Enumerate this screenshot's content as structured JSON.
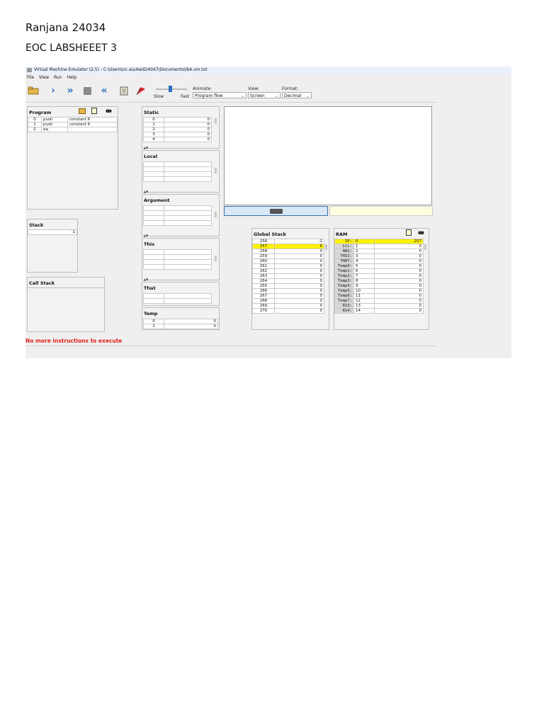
{
  "doc": {
    "author": "Ranjana 24034",
    "subtitle": "EOC LABSHEEET 3"
  },
  "window": {
    "title": "Virtual Machine Emulator (2.5) - C:\\Users\\nc.a\\u4aid24047\\Documents\\lb4.vm.txt"
  },
  "menu": [
    "File",
    "View",
    "Run",
    "Help"
  ],
  "toolbar": {
    "slow_label": "Slow",
    "fast_label": "Fast",
    "animate_label": "Animate:",
    "animate_value": "Program flow",
    "view_label": "View:",
    "view_value": "Screen",
    "format_label": "Format:",
    "format_value": "Decimal",
    "speed": 0.45
  },
  "program": {
    "title": "Program",
    "rows": [
      {
        "idx": "0",
        "op": "push",
        "arg": "constant 6"
      },
      {
        "idx": "1",
        "op": "push",
        "arg": "constant 6"
      },
      {
        "idx": "2",
        "op": "eq",
        "arg": ""
      }
    ]
  },
  "stack": {
    "title": "Stack",
    "values": [
      "-1"
    ]
  },
  "call_stack": {
    "title": "Call Stack"
  },
  "static": {
    "title": "Static",
    "rows": [
      [
        "0",
        "0"
      ],
      [
        "1",
        "0"
      ],
      [
        "2",
        "0"
      ],
      [
        "3",
        "0"
      ],
      [
        "4",
        "0"
      ]
    ]
  },
  "local": {
    "title": "Local"
  },
  "argument": {
    "title": "Argument"
  },
  "this": {
    "title": "This"
  },
  "that": {
    "title": "That"
  },
  "temp": {
    "title": "Temp",
    "rows": [
      [
        "0",
        "0"
      ],
      [
        "1",
        "0"
      ]
    ]
  },
  "global_stack": {
    "title": "Global Stack",
    "rows": [
      [
        "256",
        "-1"
      ],
      [
        "257",
        "6"
      ],
      [
        "258",
        "0"
      ],
      [
        "259",
        "0"
      ],
      [
        "260",
        "0"
      ],
      [
        "261",
        "0"
      ],
      [
        "262",
        "0"
      ],
      [
        "263",
        "0"
      ],
      [
        "264",
        "0"
      ],
      [
        "265",
        "0"
      ],
      [
        "266",
        "0"
      ],
      [
        "267",
        "0"
      ],
      [
        "268",
        "0"
      ],
      [
        "269",
        "0"
      ],
      [
        "270",
        "0"
      ]
    ],
    "highlight_row": 1
  },
  "ram": {
    "title": "RAM",
    "rows": [
      [
        "SP:",
        "0",
        "257"
      ],
      [
        "LCL:",
        "1",
        "0"
      ],
      [
        "ARG:",
        "2",
        "0"
      ],
      [
        "THIS:",
        "3",
        "0"
      ],
      [
        "THAT:",
        "4",
        "0"
      ],
      [
        "Temp0:",
        "5",
        "0"
      ],
      [
        "Temp1:",
        "6",
        "0"
      ],
      [
        "Temp2:",
        "7",
        "0"
      ],
      [
        "Temp3:",
        "8",
        "0"
      ],
      [
        "Temp4:",
        "9",
        "0"
      ],
      [
        "Temp5:",
        "10",
        "0"
      ],
      [
        "Temp6:",
        "11",
        "0"
      ],
      [
        "Temp7:",
        "12",
        "0"
      ],
      [
        "R13:",
        "13",
        "0"
      ],
      [
        "R14:",
        "14",
        "0"
      ]
    ],
    "highlight_row": 0
  },
  "status": {
    "message": "No more instructions to execute"
  },
  "colors": {
    "highlight": "#fff200",
    "status_text": "#e0201a",
    "accent": "#2a6fc2"
  }
}
